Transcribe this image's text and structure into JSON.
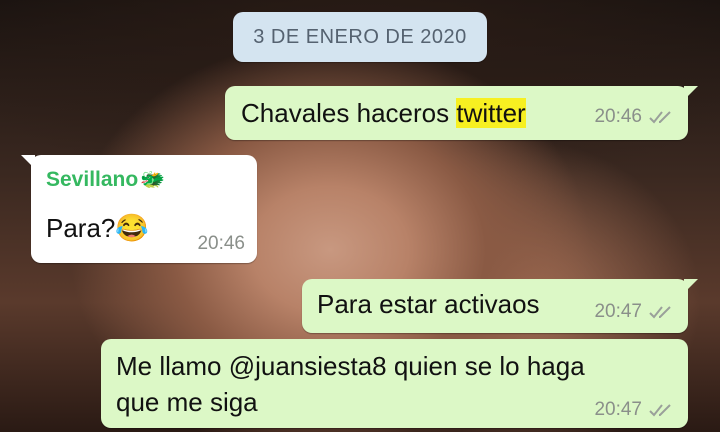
{
  "date_chip": "3 DE ENERO DE 2020",
  "messages": [
    {
      "text_before": "Chavales haceros ",
      "highlight": "twitter",
      "time": "20:46",
      "status": "read-ticks-icon"
    },
    {
      "sender": "Sevillano",
      "sender_emoji": "🐲",
      "text": "Para?",
      "emoji": "😂",
      "time": "20:46"
    },
    {
      "text": "Para estar activaos",
      "time": "20:47",
      "status": "read-ticks-icon"
    },
    {
      "line1": "Me llamo @juansiesta8 quien se lo haga",
      "line2": "que me siga",
      "time": "20:47",
      "status": "read-ticks-icon"
    }
  ],
  "colors": {
    "outgoing": "#dcf8c6",
    "incoming": "#ffffff",
    "sender_name": "#35b860",
    "highlight": "#f7f021",
    "date_chip": "#d4e4f0"
  }
}
